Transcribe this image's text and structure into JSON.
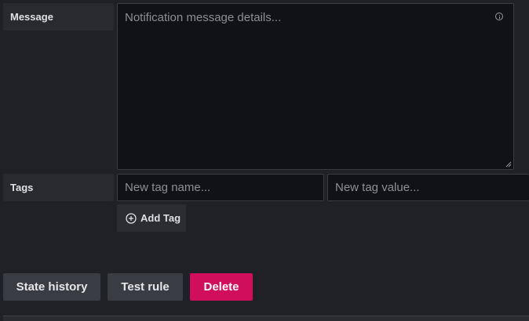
{
  "form": {
    "message": {
      "label": "Message",
      "placeholder": "Notification message details..."
    },
    "tags": {
      "label": "Tags",
      "name_placeholder": "New tag name...",
      "value_placeholder": "New tag value...",
      "add_tag_label": "Add Tag"
    }
  },
  "actions": {
    "state_history_label": "State history",
    "test_rule_label": "Test rule",
    "delete_label": "Delete"
  },
  "colors": {
    "background": "#1f2127",
    "input_background": "#111217",
    "danger": "#d10e5c",
    "secondary_button": "#3a3c43"
  },
  "icons": {
    "info": "info-icon",
    "add": "plus-circle-icon",
    "resize": "resize-handle-icon"
  }
}
